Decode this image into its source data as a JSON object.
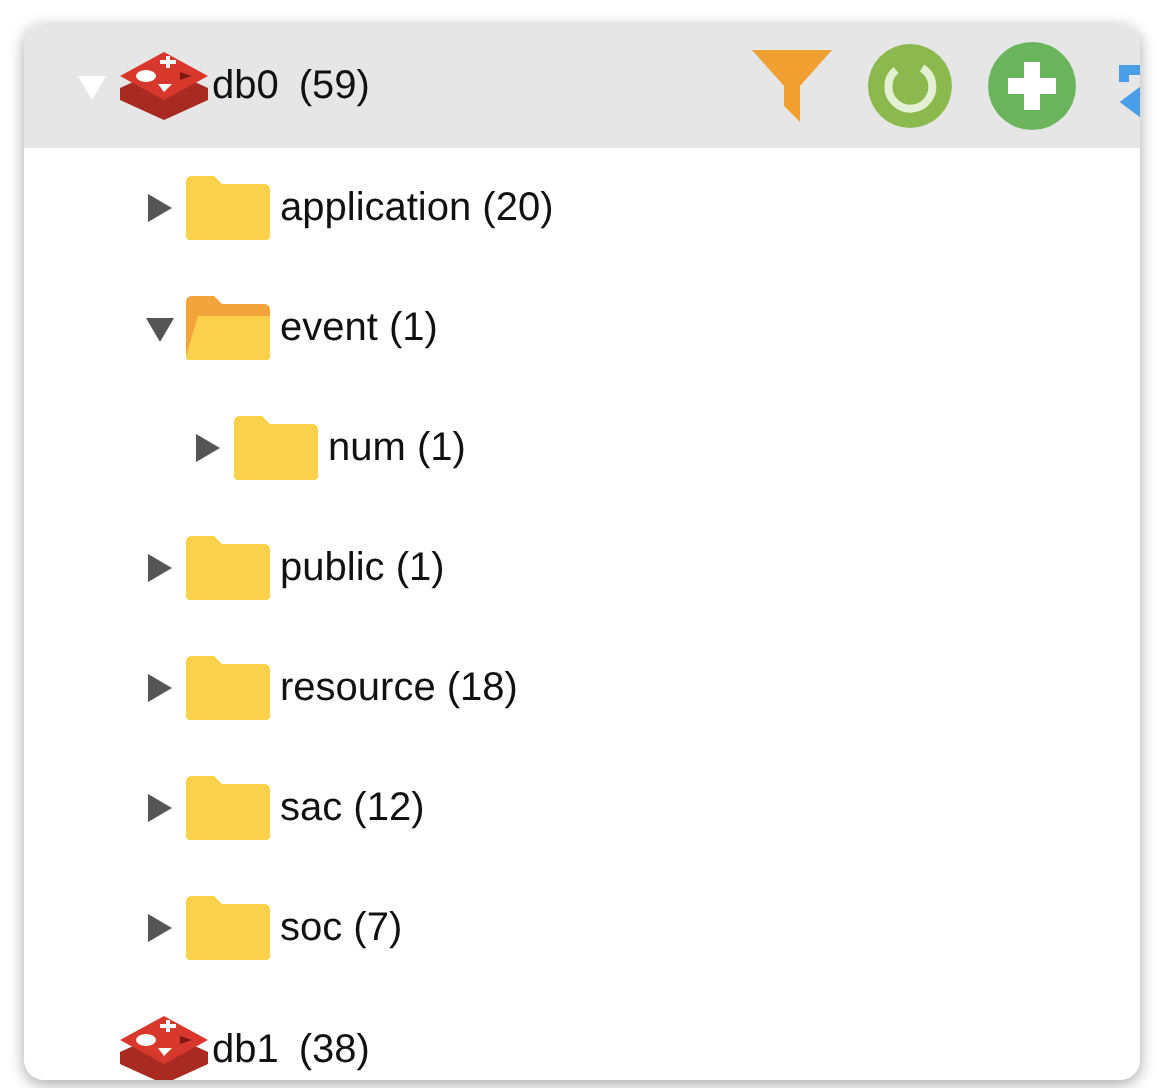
{
  "databases": [
    {
      "name": "db0",
      "count": "(59)",
      "expanded": true,
      "selected": true,
      "children": [
        {
          "label": "application (20)",
          "expanded": false
        },
        {
          "label": "event (1)",
          "expanded": true,
          "children": [
            {
              "label": "num (1)",
              "expanded": false
            }
          ]
        },
        {
          "label": "public (1)",
          "expanded": false
        },
        {
          "label": "resource (18)",
          "expanded": false
        },
        {
          "label": "sac (12)",
          "expanded": false
        },
        {
          "label": "soc (7)",
          "expanded": false
        }
      ]
    },
    {
      "name": "db1",
      "count": "(38)",
      "selected": false
    }
  ]
}
